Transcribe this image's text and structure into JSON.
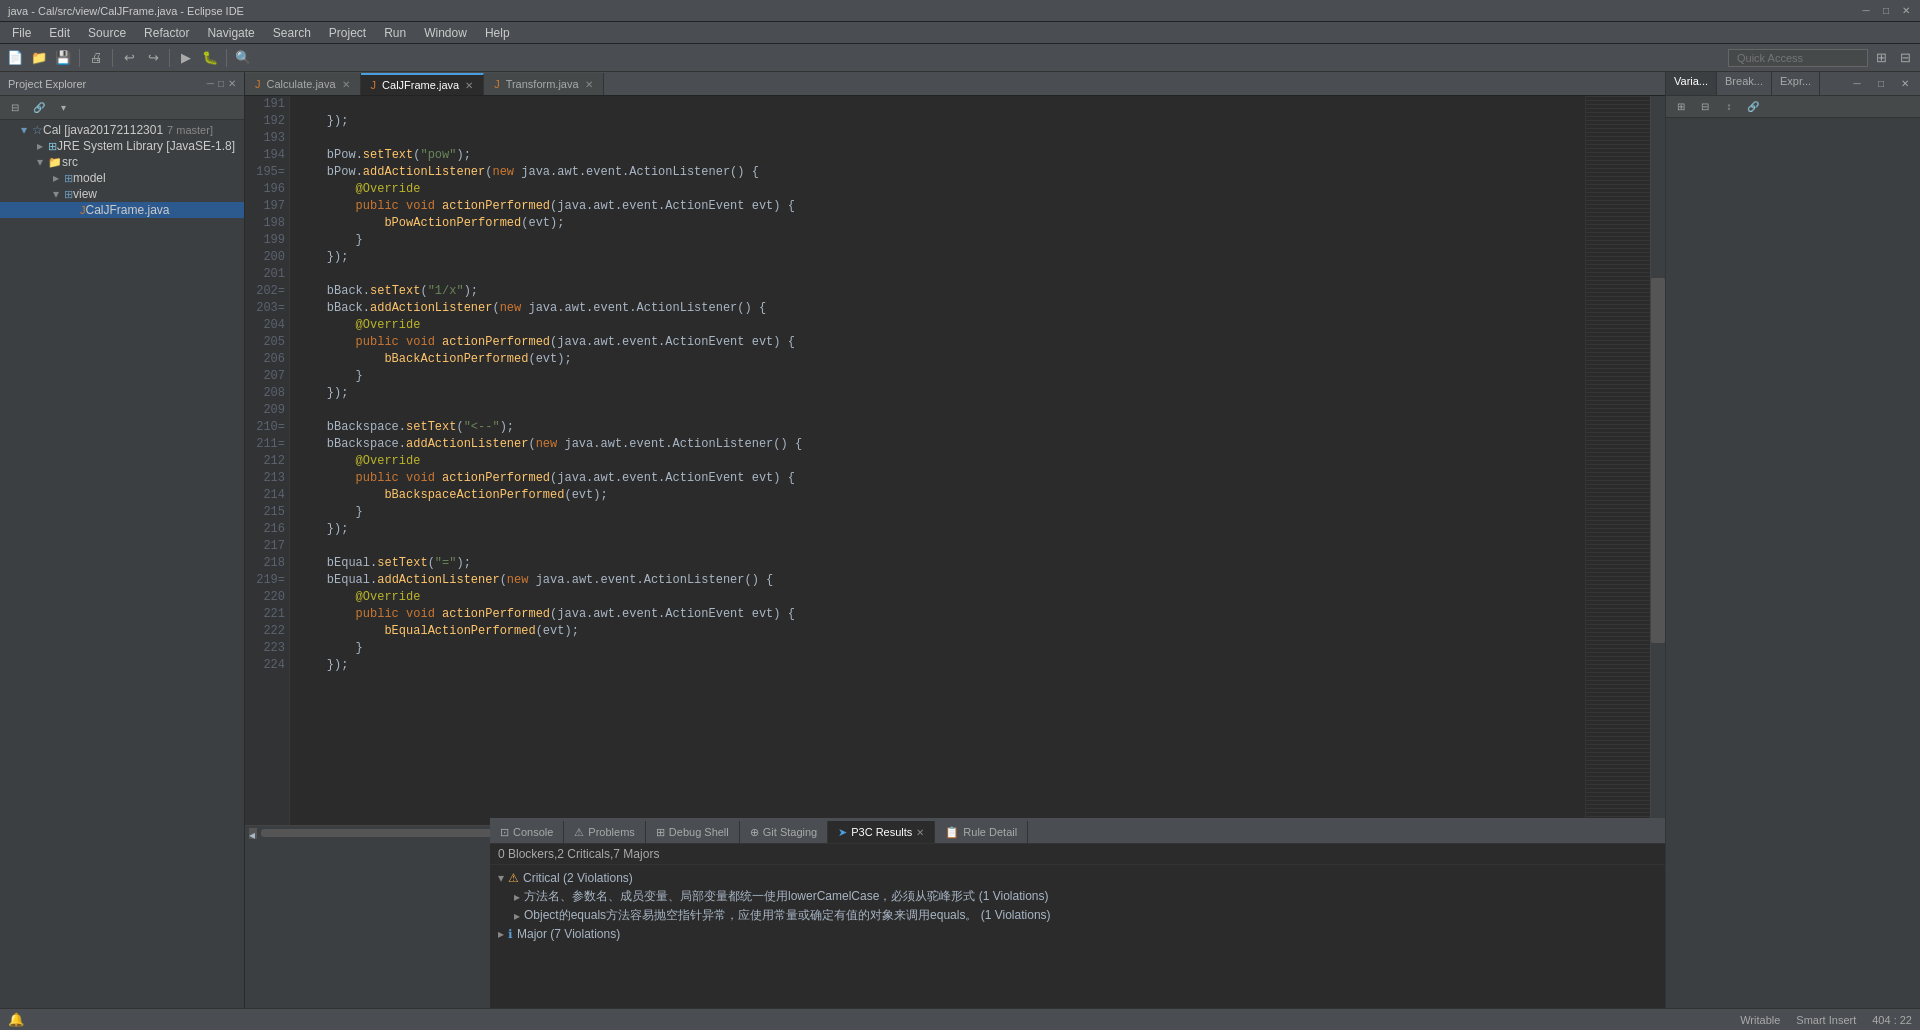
{
  "window": {
    "title": "java - Cal/src/view/CalJFrame.java - Eclipse IDE"
  },
  "menu": {
    "items": [
      "File",
      "Edit",
      "Source",
      "Refactor",
      "Navigate",
      "Search",
      "Project",
      "Run",
      "Window",
      "Help"
    ]
  },
  "toolbar": {
    "quick_access_placeholder": "Quick Access"
  },
  "project_explorer": {
    "title": "Project Explorer",
    "items": [
      {
        "label": "Cal [java20172112301",
        "sub": "7 master]",
        "indent": 1,
        "icon": "▾",
        "type": "project"
      },
      {
        "label": "JRE System Library [JavaSE-1.8]",
        "indent": 2,
        "icon": "▸",
        "type": "library"
      },
      {
        "label": "src",
        "indent": 2,
        "icon": "▾",
        "type": "folder"
      },
      {
        "label": "model",
        "indent": 3,
        "icon": "▸",
        "type": "package"
      },
      {
        "label": "view",
        "indent": 3,
        "icon": "▾",
        "type": "package"
      },
      {
        "label": "CalJFrame.java",
        "indent": 4,
        "icon": "◉",
        "type": "file",
        "selected": true
      }
    ]
  },
  "editor": {
    "tabs": [
      {
        "label": "Calculate.java",
        "icon": "J",
        "active": false,
        "modified": false
      },
      {
        "label": "CalJFrame.java",
        "icon": "J",
        "active": true,
        "modified": true
      },
      {
        "label": "Transform.java",
        "icon": "J",
        "active": false,
        "modified": false
      }
    ],
    "lines": [
      {
        "num": 191,
        "code": "    });"
      },
      {
        "num": 192,
        "code": ""
      },
      {
        "num": 193,
        "code": "    bPow.setText(\"pow\");"
      },
      {
        "num": 194,
        "code": "    bPow.addActionListener(new java.awt.event.ActionListener() {"
      },
      {
        "num": 195,
        "code": "        @Override",
        "modified": true
      },
      {
        "num": 196,
        "code": "        public void actionPerformed(java.awt.event.ActionEvent evt) {",
        "folded": true
      },
      {
        "num": 197,
        "code": "            bPowActionPerformed(evt);"
      },
      {
        "num": 198,
        "code": "        }"
      },
      {
        "num": 199,
        "code": "    });"
      },
      {
        "num": 200,
        "code": ""
      },
      {
        "num": 201,
        "code": "    bBack.setText(\"1/x\");"
      },
      {
        "num": 202,
        "code": "    bBack.addActionListener(new java.awt.event.ActionListener() {",
        "modified": true
      },
      {
        "num": 203,
        "code": "        @Override",
        "modified": true
      },
      {
        "num": 204,
        "code": "        public void actionPerformed(java.awt.event.ActionEvent evt) {",
        "folded": true
      },
      {
        "num": 205,
        "code": "            bBackActionPerformed(evt);"
      },
      {
        "num": 206,
        "code": "        }"
      },
      {
        "num": 207,
        "code": "    });"
      },
      {
        "num": 208,
        "code": ""
      },
      {
        "num": 209,
        "code": "    bBackspace.setText(\"<--\");"
      },
      {
        "num": 210,
        "code": "    bBackspace.addActionListener(new java.awt.event.ActionListener() {",
        "modified": true
      },
      {
        "num": 211,
        "code": "        @Override",
        "modified": true
      },
      {
        "num": 212,
        "code": "        public void actionPerformed(java.awt.event.ActionEvent evt) {",
        "folded": true
      },
      {
        "num": 213,
        "code": "            bBackspaceActionPerformed(evt);"
      },
      {
        "num": 214,
        "code": "        }"
      },
      {
        "num": 215,
        "code": "    });"
      },
      {
        "num": 216,
        "code": ""
      },
      {
        "num": 217,
        "code": "    bEqual.setText(\"=\");"
      },
      {
        "num": 218,
        "code": "    bEqual.addActionListener(new java.awt.event.ActionListener() {"
      },
      {
        "num": 219,
        "code": "        @Override",
        "modified": true
      },
      {
        "num": 220,
        "code": "        public void actionPerformed(java.awt.event.ActionEvent evt) {",
        "folded": true
      },
      {
        "num": 221,
        "code": "            bEqualActionPerformed(evt);"
      },
      {
        "num": 222,
        "code": "        }"
      },
      {
        "num": 223,
        "code": "    });"
      },
      {
        "num": 224,
        "code": ""
      }
    ]
  },
  "right_panel": {
    "tabs": [
      "Varia...",
      "Break...",
      "Expr..."
    ]
  },
  "bottom_panel": {
    "tabs": [
      "Console",
      "Problems",
      "Debug Shell",
      "Git Staging",
      "P3C Results",
      "Rule Detail"
    ],
    "active_tab": "P3C Results",
    "summary": "0 Blockers,2 Criticals,7 Majors",
    "groups": [
      {
        "label": "Critical (2 Violations)",
        "icon": "⚠",
        "expanded": true,
        "items": [
          {
            "text": "方法名、参数名、成员变量、局部变量都统一使用lowerCamelCase，必须从驼峰形式 (1 Violations)"
          },
          {
            "text": "Object的equals方法容易抛空指针异常，应使用常量或确定有值的对象来调用equals。 (1 Violations)"
          }
        ]
      },
      {
        "label": "Major (7 Violations)",
        "icon": "▸",
        "expanded": false,
        "items": []
      }
    ]
  },
  "status_bar": {
    "writable": "Writable",
    "insert_mode": "Smart Insert",
    "position": "404 : 22"
  }
}
